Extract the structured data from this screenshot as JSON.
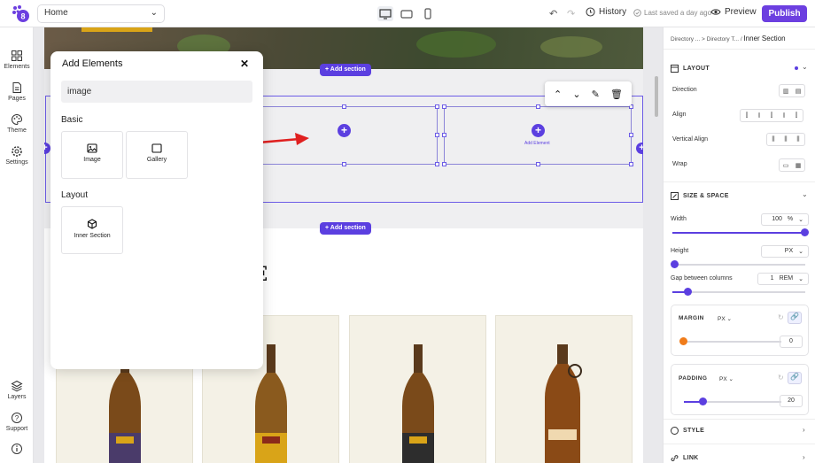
{
  "topbar": {
    "page_select": "Home",
    "history_label": "History",
    "saved_label": "Last saved a day ago",
    "preview_label": "Preview",
    "publish_label": "Publish"
  },
  "leftbar": {
    "items": [
      {
        "label": "Elements",
        "icon": "grid-icon"
      },
      {
        "label": "Pages",
        "icon": "page-icon"
      },
      {
        "label": "Theme",
        "icon": "palette-icon"
      },
      {
        "label": "Settings",
        "icon": "gear-icon"
      },
      {
        "label": "Layers",
        "icon": "layers-icon"
      },
      {
        "label": "Support",
        "icon": "help-icon"
      }
    ]
  },
  "modal": {
    "title": "Add Elements",
    "search_value": "image",
    "sections": [
      {
        "label": "Basic",
        "tiles": [
          "Image",
          "Gallery"
        ]
      },
      {
        "label": "Layout",
        "tiles": [
          "Inner Section"
        ]
      }
    ]
  },
  "canvas": {
    "add_section": "+ Add section",
    "add_element": "Add Element",
    "heading_fragment": "TE"
  },
  "rightbar": {
    "breadcrumb": [
      "Directory ...",
      "Directory T...",
      "Inner Section"
    ],
    "layout_header": "LAYOUT",
    "direction_label": "Direction",
    "align_label": "Align",
    "vertical_align_label": "Vertical Align",
    "wrap_label": "Wrap",
    "size_header": "SIZE & SPACE",
    "width_label": "Width",
    "width_value": "100",
    "width_unit": "%",
    "height_label": "Height",
    "height_unit": "PX",
    "gap_label": "Gap between columns",
    "gap_value": "1",
    "gap_unit": "REM",
    "margin_label": "MARGIN",
    "margin_unit": "PX",
    "margin_value": "0",
    "padding_label": "PADDING",
    "padding_unit": "PX",
    "padding_value": "20",
    "style_header": "STYLE",
    "link_header": "LINK"
  },
  "colors": {
    "accent": "#5b3fe0",
    "publish": "#6c3fe0",
    "arrow": "#e02020",
    "margin_knob": "#f07c1a"
  }
}
